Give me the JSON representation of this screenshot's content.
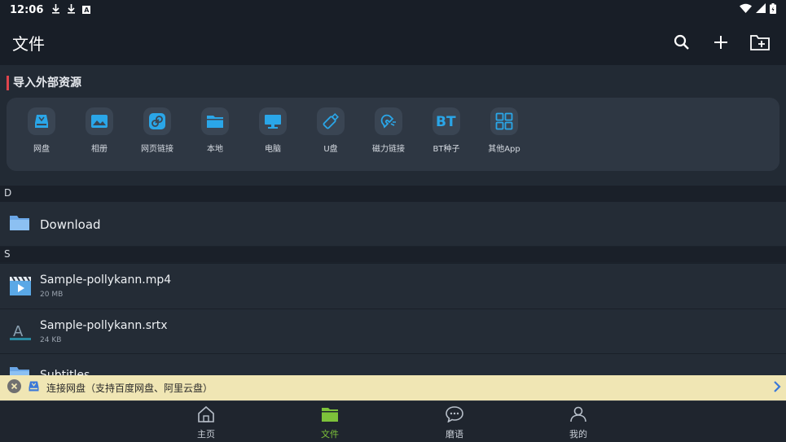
{
  "status_bar": {
    "time": "12:06",
    "indicators": [
      "download-icon",
      "download-icon",
      "a-icon"
    ],
    "right_icons": [
      "wifi-icon",
      "signal-icon",
      "battery-icon"
    ]
  },
  "app_bar": {
    "title": "文件",
    "actions": [
      "search-icon",
      "plus-icon",
      "new-folder-icon"
    ]
  },
  "import_section": {
    "title": "导入外部资源",
    "accent_color": "#e0444c",
    "items": [
      {
        "label": "网盘",
        "icon": "cloud-drive-icon"
      },
      {
        "label": "相册",
        "icon": "photo-album-icon"
      },
      {
        "label": "网页链接",
        "icon": "link-icon"
      },
      {
        "label": "本地",
        "icon": "folder-icon"
      },
      {
        "label": "电脑",
        "icon": "computer-icon"
      },
      {
        "label": "U盘",
        "icon": "usb-drive-icon"
      },
      {
        "label": "磁力链接",
        "icon": "magnet-icon"
      },
      {
        "label": "BT种子",
        "icon": "bt-icon"
      },
      {
        "label": "其他App",
        "icon": "apps-grid-icon"
      }
    ]
  },
  "sections": [
    {
      "header": "D",
      "files": [
        {
          "name": "Download",
          "size": "",
          "type": "folder"
        }
      ]
    },
    {
      "header": "S",
      "files": [
        {
          "name": "Sample-pollykann.mp4",
          "size": "20 MB",
          "type": "video"
        },
        {
          "name": "Sample-pollykann.srtx",
          "size": "24 KB",
          "type": "subtitle"
        },
        {
          "name": "Subtitles",
          "size": "",
          "type": "folder"
        }
      ]
    }
  ],
  "banner": {
    "text": "连接网盘（支持百度网盘、阿里云盘）",
    "background": "#f0e6b4"
  },
  "bottom_nav": {
    "active_color": "#7dc23a",
    "items": [
      {
        "label": "主页",
        "icon": "home-icon",
        "active": false
      },
      {
        "label": "文件",
        "icon": "files-icon",
        "active": true
      },
      {
        "label": "磨语",
        "icon": "chat-icon",
        "active": false
      },
      {
        "label": "我的",
        "icon": "profile-icon",
        "active": false
      }
    ]
  }
}
